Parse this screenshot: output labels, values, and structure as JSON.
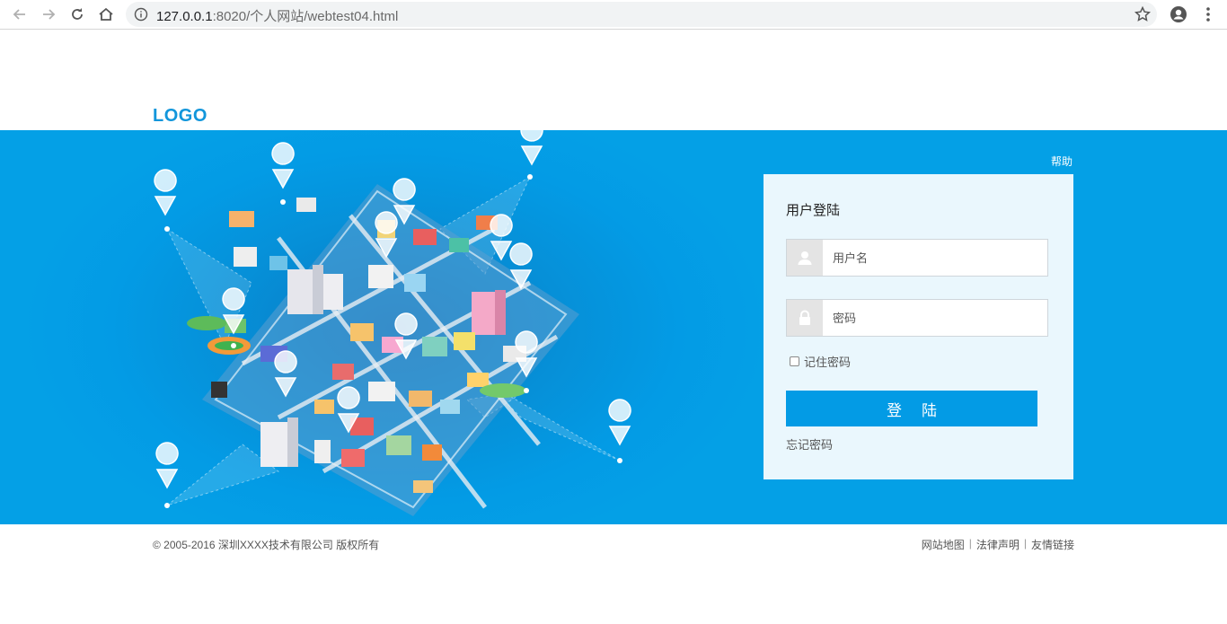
{
  "browser": {
    "url_host": "127.0.0.1",
    "url_path": ":8020/个人网站/webtest04.html"
  },
  "header": {
    "logo": "LOGO"
  },
  "banner": {
    "help": "帮助"
  },
  "login": {
    "title": "用户登陆",
    "username_placeholder": "用户名",
    "password_placeholder": "密码",
    "remember": "记住密码",
    "submit": "登陆",
    "forgot": "忘记密码"
  },
  "footer": {
    "copyright": "© 2005-2016 深圳XXXX技术有限公司 版权所有",
    "links": [
      "网站地图",
      "法律声明",
      "友情链接"
    ]
  },
  "colors": {
    "brand": "#039be5",
    "logo": "#1296db",
    "panel_bg": "#eaf7fd"
  }
}
